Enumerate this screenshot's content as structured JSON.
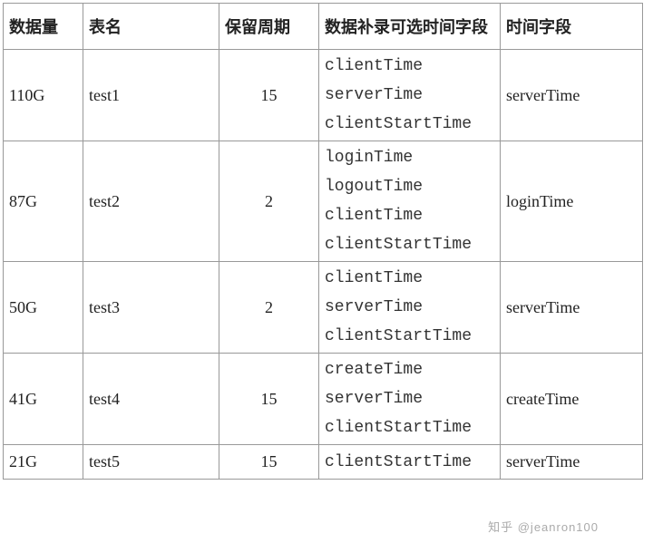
{
  "headers": {
    "data_size": "数据量",
    "table_name": "表名",
    "retention": "保留周期",
    "optional_fields": "数据补录可选时间字段",
    "time_field": "时间字段"
  },
  "rows": [
    {
      "data_size": "110G",
      "table_name": "test1",
      "retention": "15",
      "optional_fields": [
        "clientTime",
        "serverTime",
        "clientStartTime"
      ],
      "time_field": "serverTime"
    },
    {
      "data_size": "87G",
      "table_name": "test2",
      "retention": "2",
      "optional_fields": [
        "loginTime",
        "logoutTime",
        "clientTime",
        "clientStartTime"
      ],
      "time_field": "loginTime"
    },
    {
      "data_size": "50G",
      "table_name": "test3",
      "retention": "2",
      "optional_fields": [
        "clientTime",
        "serverTime",
        "clientStartTime"
      ],
      "time_field": "serverTime"
    },
    {
      "data_size": "41G",
      "table_name": "test4",
      "retention": "15",
      "optional_fields": [
        "createTime",
        "serverTime",
        "clientStartTime"
      ],
      "time_field": "createTime"
    },
    {
      "data_size": "21G",
      "table_name": "test5",
      "retention": "15",
      "optional_fields": [
        "clientStartTime"
      ],
      "time_field": "serverTime"
    }
  ],
  "watermark": "知乎 @jeanron100"
}
